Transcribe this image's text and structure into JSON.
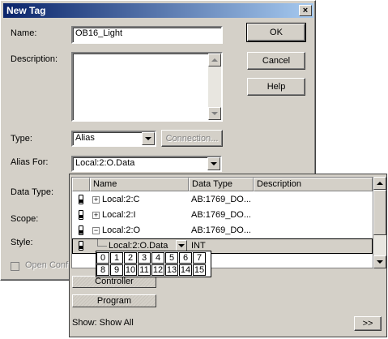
{
  "window": {
    "title": "New Tag",
    "close_glyph": "×"
  },
  "fields": {
    "name_label": "Name:",
    "name_value": "OB16_Light",
    "description_label": "Description:",
    "description_value": "",
    "type_label": "Type:",
    "type_value": "Alias",
    "connection_button": "Connection...",
    "alias_for_label": "Alias For:",
    "alias_for_value": "Local:2:O.Data",
    "data_type_label": "Data Type:",
    "scope_label": "Scope:",
    "style_label": "Style:",
    "open_config_label": "Open Confi"
  },
  "buttons": {
    "ok": "OK",
    "cancel": "Cancel",
    "help": "Help"
  },
  "tag_browser": {
    "columns": [
      "Name",
      "Data Type",
      "Description"
    ],
    "rows": [
      {
        "expander": "+",
        "name": "Local:2:C",
        "type": "AB:1769_DO..."
      },
      {
        "expander": "+",
        "name": "Local:2:I",
        "type": "AB:1769_DO..."
      },
      {
        "expander": "−",
        "name": "Local:2:O",
        "type": "AB:1769_DO..."
      },
      {
        "expander": "",
        "name": "Local:2:O.Data",
        "type": "INT",
        "selected": true
      }
    ],
    "bits_row1": [
      "0",
      "1",
      "2",
      "3",
      "4",
      "5",
      "6",
      "7"
    ],
    "bits_row2": [
      "8",
      "9",
      "10",
      "11",
      "12",
      "13",
      "14",
      "15"
    ],
    "scope_controller": "Controller",
    "scope_program": "Program",
    "show_label": "Show: Show All",
    "more_button": ">>"
  },
  "colors": {
    "titlebar_start": "#0a246a",
    "titlebar_end": "#a6caf0",
    "selection": "#d4d0c8"
  }
}
